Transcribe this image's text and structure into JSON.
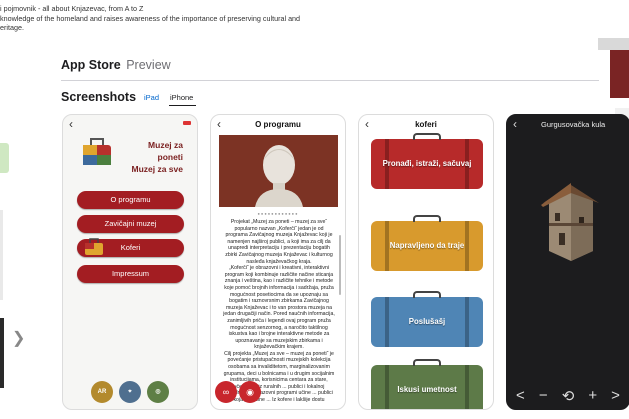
{
  "description": {
    "line1": "i pojmovnik - all about Knjazevac, from A to Z",
    "line2": " knowledge of the homeland and raises awareness of the importance of preserving cultural and",
    "line3": "eritage."
  },
  "header": {
    "store_name": "App Store",
    "store_suffix": "Preview"
  },
  "screenshots": {
    "title": "Screenshots",
    "tabs": [
      {
        "label": "iPad",
        "selected": false
      },
      {
        "label": "iPhone",
        "selected": true
      }
    ]
  },
  "phone1": {
    "logo_line1": "Muzej za poneti",
    "logo_line2": "Muzej za sve",
    "menu": [
      "O programu",
      "Zavičajni muzej",
      "Koferi",
      "Impressum"
    ],
    "bottom_icons": [
      "AR",
      "",
      ""
    ]
  },
  "phone2": {
    "title": "O programu",
    "body": "Projekat „Muzej za poneti – muzej za sve“ popularno nazvan „Koferči“ jedan je od programa Zavičajnog muzeja Knjaževac koji je namenjen najširoj publici, a koji ima za cilj da unapredi interpretaciju i prezentaciju bogatih zbirki Zavičajnog muzeja Knjaževac i kulturnog nasleđa knjaževačkog kraja.\n„Koferči“ je obrazovni i kreativni, interaktivni program koji kombinuje različite načine sticanja znanja i veština, kao i različite tehnike i metode koje pomoć brojnih informacija i sadržaja, pruža mogućnost posetiocima da se upoznaju sa bogatim i raznovrsnim zbirkama Zavičajnog muzeja Knjaževac i to van prostora muzeja na jedan drugačiji način. Pored naučnih informacija, zanimljivih priča i legendi ovaj program pruža mogućnost senzornog, a naročito taktilnog iskustva kao i brojne interaktivne metode za upoznavanje sa muzejskim zbirkama i knjaževačkim krajem.\nCilj projekta „Muzej za sve – muzej za poneti“ je povećanje pristupačnosti muzejskih kolekcija osobama sa invaliditetom, marginalizovanim grupama, deci u bolnicama i u drugim socijalnim institucijama, korisnicima centara za stare, učenicima iz ruralnih ... publici i lokalnoj zajednici ... obrazovni programi učine ... publici koja potrebne ... Iz kofere i lakšije dostu"
  },
  "phone3": {
    "title": "koferi",
    "suitcases": [
      "Pronađi, istraži, sačuvaj",
      "Napravljeno da traje",
      "Poslušašj",
      "Iskusi umetnost"
    ]
  },
  "phone4": {
    "title": "Gurgusovačka kula",
    "controls": [
      "<",
      "−",
      "⟲",
      "+",
      ">"
    ]
  },
  "colors": {
    "menu_red": "#a31d22",
    "tab_blue": "#0066cc"
  }
}
